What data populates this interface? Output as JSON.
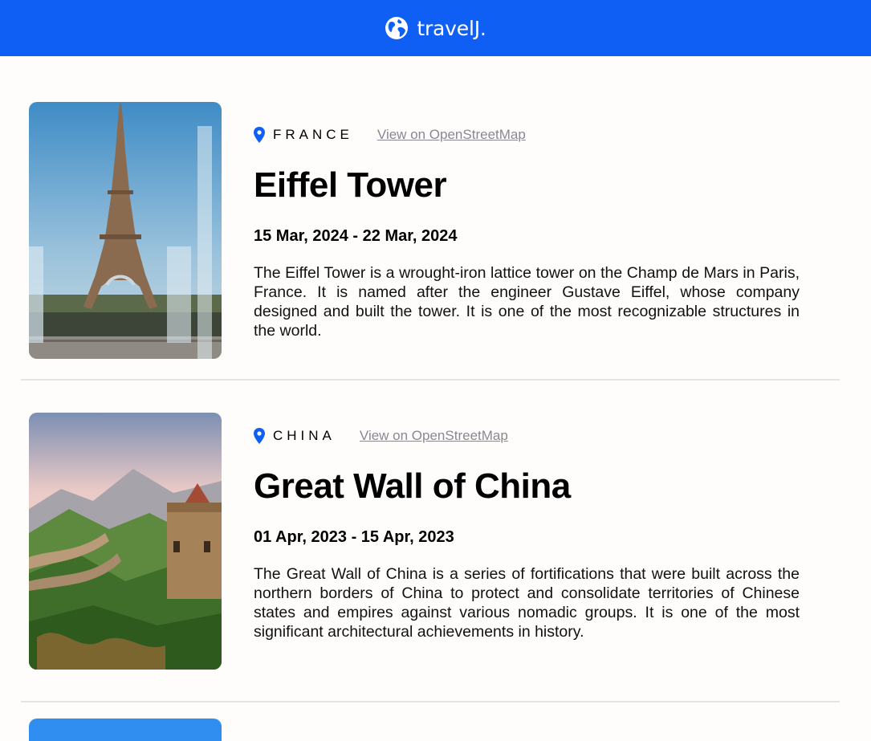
{
  "header": {
    "brand": "travelJ.",
    "icon": "globe-icon"
  },
  "entries": [
    {
      "country": "FRANCE",
      "map_link": "View on OpenStreetMap",
      "title": "Eiffel Tower",
      "dates": "15 Mar, 2024 - 22 Mar, 2024",
      "description": "The Eiffel Tower is a wrought-iron lattice tower on the Champ de Mars in Paris, France. It is named after the engineer Gustave Eiffel, whose company designed and built the tower. It is one of the most recognizable structures in the world."
    },
    {
      "country": "CHINA",
      "map_link": "View on OpenStreetMap",
      "title": "Great Wall of China",
      "dates": "01 Apr, 2023 - 15 Apr, 2023",
      "description": "The Great Wall of China is a series of fortifications that were built across the northern borders of China to protect and consolidate territories of Chinese states and empires against various nomadic groups. It is one of the most significant architectural achievements in history."
    }
  ],
  "colors": {
    "accent": "#0f5ff5",
    "link": "#8a8792",
    "divider": "#e6e4e3"
  }
}
